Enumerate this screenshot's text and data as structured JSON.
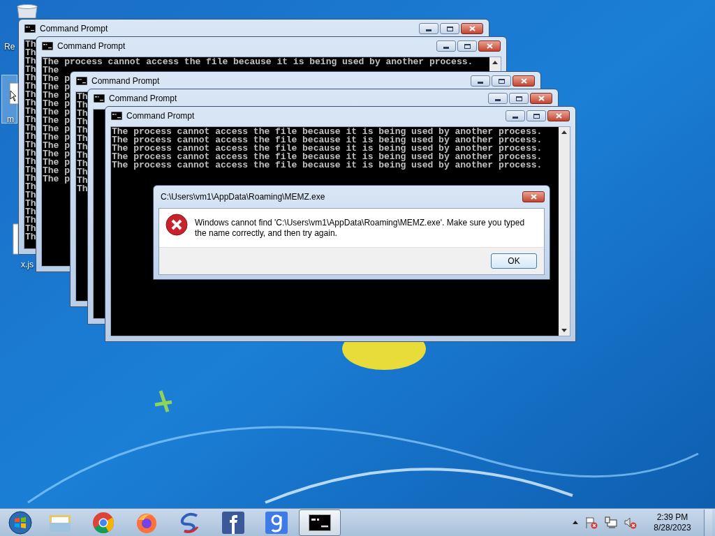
{
  "desktop_icons": [
    {
      "label": "Re",
      "selected": false
    },
    {
      "label": "m",
      "selected": true
    },
    {
      "label": "x.js",
      "selected": false
    }
  ],
  "windows": [
    {
      "title": "Command Prompt",
      "lines": [
        "Th",
        "Th",
        "Th",
        "Th",
        "Th",
        "Th",
        "Th",
        "Th",
        "Th",
        "Th",
        "Th",
        "Th",
        "Th",
        "Th",
        "Th",
        "Th",
        "Th",
        "Th",
        "Th",
        "Th",
        "Th",
        "Th",
        "Th",
        "Th"
      ]
    },
    {
      "title": "Command Prompt",
      "lines": [
        "The process cannot access the file because it is being used by another process.",
        "The",
        "The p",
        "The p",
        "The p",
        "The p",
        "The p",
        "The p",
        "The p",
        "The p",
        "The p",
        "The p",
        "The p",
        "The p",
        "The p"
      ]
    },
    {
      "title": "Command Prompt",
      "lines": [
        "Th",
        "Th",
        "Th",
        "Th",
        "Th",
        "Th",
        "Th",
        "Th",
        "Th",
        "Th",
        "Th",
        "Th"
      ]
    },
    {
      "title": "Command Prompt"
    },
    {
      "title": "Command Prompt",
      "lines": [
        "The process cannot access the file because it is being used by another process.",
        "The process cannot access the file because it is being used by another process.",
        "The process cannot access the file because it is being used by another process.",
        "The process cannot access the file because it is being used by another process.",
        "The process cannot access the file because it is being used by another process."
      ]
    }
  ],
  "dialog": {
    "title": "C:\\Users\\vm1\\AppData\\Roaming\\MEMZ.exe",
    "message": "Windows cannot find 'C:\\Users\\vm1\\AppData\\Roaming\\MEMZ.exe'. Make sure you typed the name correctly, and then try again.",
    "button": "OK"
  },
  "taskbar": {
    "items": [
      {
        "kind": "start",
        "selected": false
      },
      {
        "kind": "folder",
        "selected": false
      },
      {
        "kind": "chrome",
        "selected": false
      },
      {
        "kind": "firefox",
        "selected": false
      },
      {
        "kind": "swirl",
        "selected": false
      },
      {
        "kind": "facebook",
        "selected": false
      },
      {
        "kind": "google",
        "selected": false
      },
      {
        "kind": "cmd",
        "selected": true
      }
    ],
    "clock": {
      "time": "2:39 PM",
      "date": "8/28/2023"
    }
  }
}
